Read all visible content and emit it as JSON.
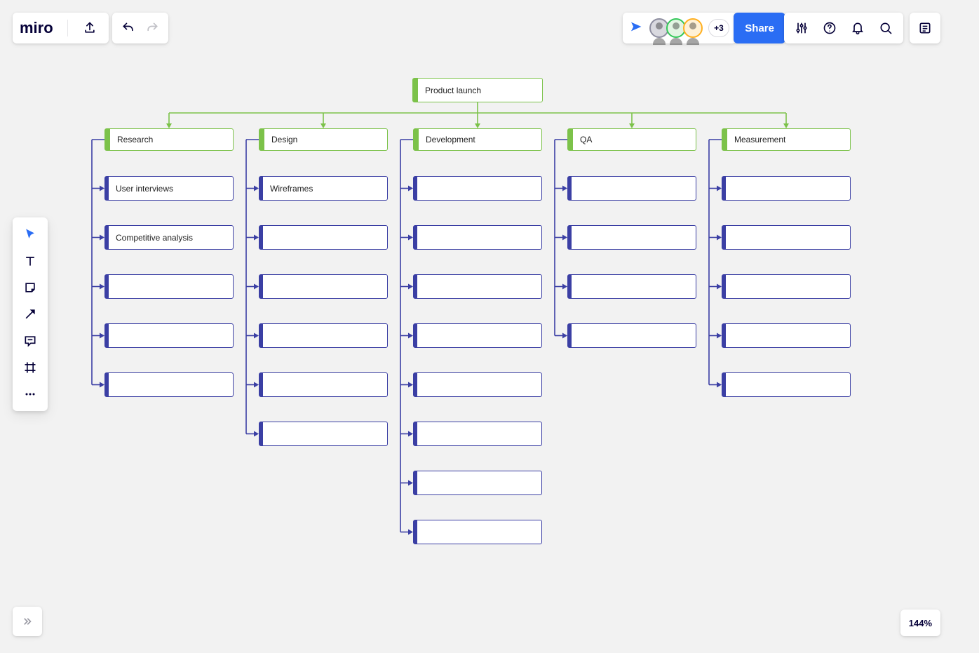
{
  "app": {
    "logo": "miro"
  },
  "toolbar": {
    "share": "Share",
    "presence_more": "+3"
  },
  "zoom": "144%",
  "diagram": {
    "root": "Product launch",
    "columns": [
      {
        "title": "Research",
        "items": [
          "User interviews",
          "Competitive analysis",
          "",
          "",
          ""
        ]
      },
      {
        "title": "Design",
        "items": [
          "Wireframes",
          "",
          "",
          "",
          "",
          ""
        ]
      },
      {
        "title": "Development",
        "items": [
          "",
          "",
          "",
          "",
          "",
          "",
          "",
          ""
        ]
      },
      {
        "title": "QA",
        "items": [
          "",
          "",
          "",
          ""
        ]
      },
      {
        "title": "Measurement",
        "items": [
          "",
          "",
          "",
          "",
          ""
        ]
      }
    ]
  }
}
